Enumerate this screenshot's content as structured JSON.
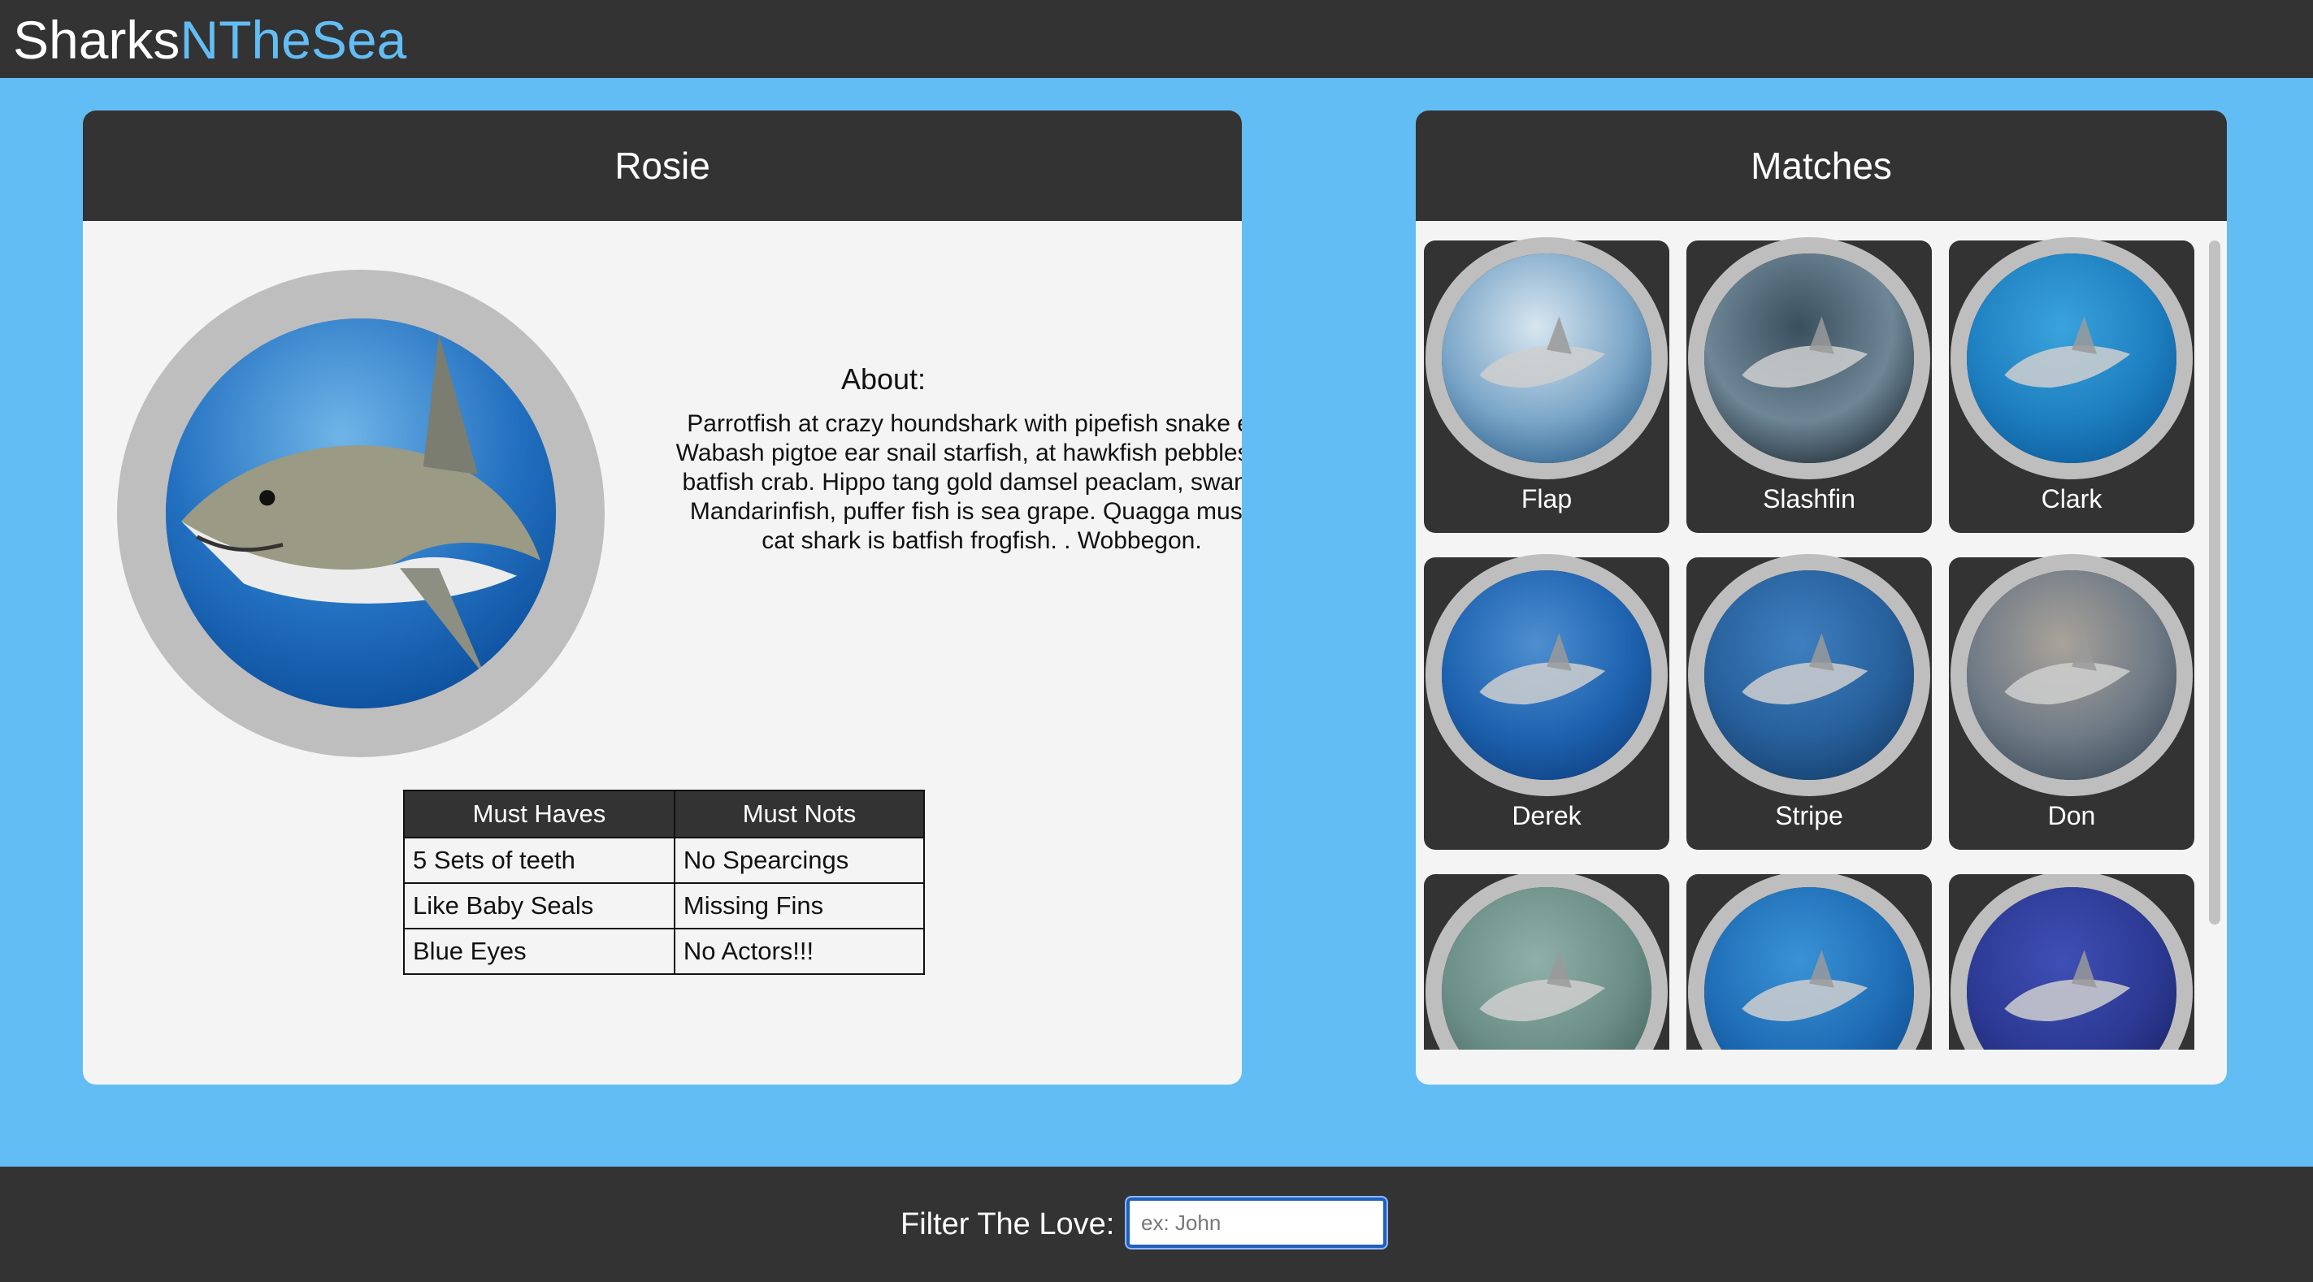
{
  "header": {
    "brand_part1": "Sharks",
    "brand_part2": "NTheSea"
  },
  "profile": {
    "name": "Rosie",
    "about_title": "About:",
    "about_text": "Parrotfish at crazy houndshark with pipefish snake eel. Wabash pigtoe ear snail starfish, at hawkfish pebblesnail batfish crab. Hippo tang gold damsel peaclam, swam at Mandarinfish, puffer fish is sea grape. Quagga mussel cat shark is batfish frogfish. . Wobbegon.",
    "table": {
      "headers": [
        "Must Haves",
        "Must Nots"
      ],
      "rows": [
        [
          "5 Sets of teeth",
          "No Spearcings"
        ],
        [
          "Like Baby Seals",
          "Missing Fins"
        ],
        [
          "Blue Eyes",
          "No Actors!!!"
        ]
      ]
    }
  },
  "matches": {
    "title": "Matches",
    "items": [
      {
        "name": "Flap",
        "icon": "shark-photo"
      },
      {
        "name": "Slashfin",
        "icon": "shark-photo"
      },
      {
        "name": "Clark",
        "icon": "shark-photo"
      },
      {
        "name": "Derek",
        "icon": "shark-photo"
      },
      {
        "name": "Stripe",
        "icon": "shark-photo"
      },
      {
        "name": "Don",
        "icon": "shark-photo"
      },
      {
        "name": "",
        "icon": "shark-photo"
      },
      {
        "name": "",
        "icon": "shark-photo"
      },
      {
        "name": "",
        "icon": "shark-photo"
      }
    ]
  },
  "footer": {
    "filter_label": "Filter The Love:",
    "filter_placeholder": "ex: John"
  },
  "colors": {
    "background": "#63bdf5",
    "bar": "#333333",
    "panel": "#f4f4f4",
    "ring": "#bebebe",
    "accent": "#63bdf5"
  }
}
